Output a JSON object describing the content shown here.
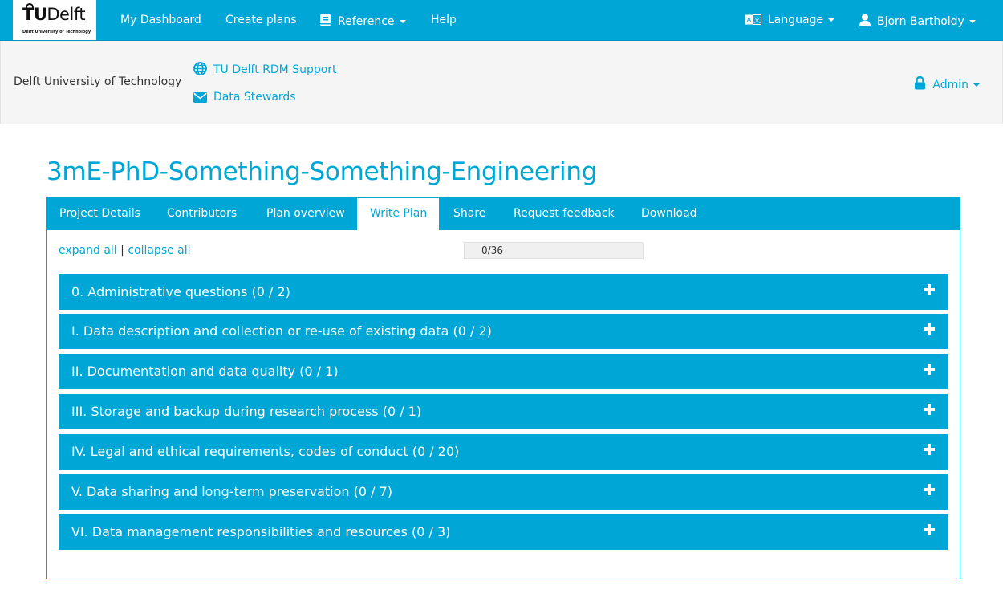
{
  "colors": {
    "brand": "#00a6d6",
    "subheader_bg": "#f5f5f5"
  },
  "navbar": {
    "logo_tu": "TU",
    "logo_delft": "Delft",
    "logo_sub": "Delft University of Technology",
    "links": {
      "dashboard": "My Dashboard",
      "create_plans": "Create plans",
      "reference": "Reference",
      "help": "Help",
      "language": "Language",
      "user": "Bjorn Bartholdy"
    },
    "icons": {
      "reference": "book-icon",
      "language": "language-icon",
      "user": "user-icon"
    }
  },
  "subheader": {
    "org_name": "Delft University of Technology",
    "support_link": "TU Delft RDM Support",
    "stewards_link": "Data Stewards",
    "admin": "Admin",
    "icons": {
      "support": "globe-icon",
      "stewards": "envelope-icon",
      "admin": "lock-icon"
    }
  },
  "plan": {
    "title": "3mE-PhD-Something-Something-Engineering",
    "tabs": [
      {
        "label": "Project Details"
      },
      {
        "label": "Contributors"
      },
      {
        "label": "Plan overview"
      },
      {
        "label": "Write Plan",
        "active": true
      },
      {
        "label": "Share"
      },
      {
        "label": "Request feedback"
      },
      {
        "label": "Download"
      }
    ],
    "expand_all": "expand all",
    "separator": "|",
    "collapse_all": "collapse all",
    "progress_text": "0/36",
    "progress_fraction": 0,
    "sections": [
      {
        "label": "0. Administrative questions (0 / 2)"
      },
      {
        "label": "I. Data description and collection or re-use of existing data (0 / 2)"
      },
      {
        "label": "II. Documentation and data quality (0 / 1)"
      },
      {
        "label": "III. Storage and backup during research process (0 / 1)"
      },
      {
        "label": "IV. Legal and ethical requirements, codes of conduct (0 / 20)"
      },
      {
        "label": "V. Data sharing and long-term preservation (0 / 7)"
      },
      {
        "label": "VI. Data management responsibilities and resources (0 / 3)"
      }
    ]
  }
}
